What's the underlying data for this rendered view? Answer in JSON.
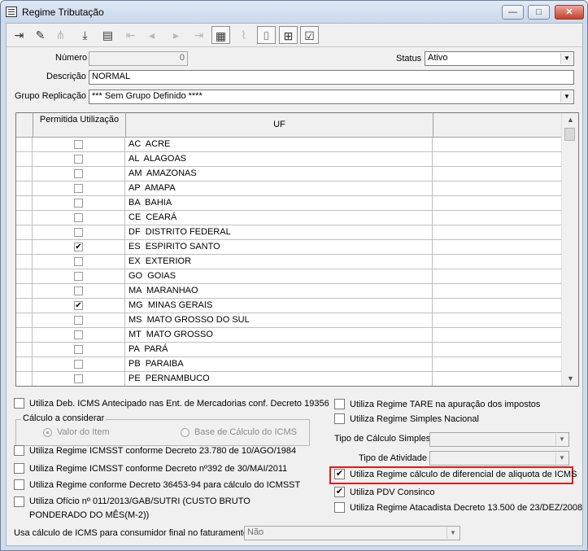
{
  "window": {
    "title": "Regime Tributação",
    "min_symbol": "—",
    "max_symbol": "□",
    "close_symbol": "✕"
  },
  "toolbar": {
    "icons": [
      {
        "name": "exit-icon",
        "glyph": "⇥",
        "enabled": true
      },
      {
        "name": "edit-icon",
        "glyph": "✎",
        "enabled": true
      },
      {
        "name": "tree-icon",
        "glyph": "⋔",
        "enabled": false
      },
      {
        "name": "download-icon",
        "glyph": "⤓",
        "enabled": true
      },
      {
        "name": "tray-icon",
        "glyph": "▤",
        "enabled": true
      },
      {
        "name": "first-icon",
        "glyph": "⇤",
        "enabled": false
      },
      {
        "name": "prev-icon",
        "glyph": "◂",
        "enabled": false
      },
      {
        "name": "next-icon",
        "glyph": "▸",
        "enabled": false
      },
      {
        "name": "last-icon",
        "glyph": "⇥",
        "enabled": false
      },
      {
        "name": "film-icon",
        "glyph": "▦",
        "enabled": true,
        "boxed": true
      },
      {
        "name": "chart-icon",
        "glyph": "⌇",
        "enabled": false
      },
      {
        "name": "camera-icon",
        "glyph": "⌷",
        "enabled": true,
        "boxed": true
      },
      {
        "name": "structure-icon",
        "glyph": "⊞",
        "enabled": true,
        "boxed": true
      },
      {
        "name": "checklist-icon",
        "glyph": "☑",
        "enabled": true,
        "boxed": true
      }
    ]
  },
  "form": {
    "numero_label": "Número",
    "numero_value": "0",
    "status_label": "Status",
    "status_value": "Ativo",
    "descricao_label": "Descrição",
    "descricao_value": "NORMAL",
    "grupo_label": "Grupo Replicação",
    "grupo_value": "*** Sem Grupo Definido ****"
  },
  "grid": {
    "col_permitida": "Permitida Utilização",
    "col_uf": "UF",
    "rows": [
      {
        "uf": "AC  ACRE",
        "checked": false
      },
      {
        "uf": "AL  ALAGOAS",
        "checked": false
      },
      {
        "uf": "AM  AMAZONAS",
        "checked": false
      },
      {
        "uf": "AP  AMAPA",
        "checked": false
      },
      {
        "uf": "BA  BAHIA",
        "checked": false
      },
      {
        "uf": "CE  CEARÁ",
        "checked": false
      },
      {
        "uf": "DF  DISTRITO FEDERAL",
        "checked": false
      },
      {
        "uf": "ES  ESPIRITO SANTO",
        "checked": true
      },
      {
        "uf": "EX  EXTERIOR",
        "checked": false
      },
      {
        "uf": "GO  GOIAS",
        "checked": false
      },
      {
        "uf": "MA  MARANHAO",
        "checked": false
      },
      {
        "uf": "MG  MINAS GERAIS",
        "checked": true
      },
      {
        "uf": "MS  MATO GROSSO DO SUL",
        "checked": false
      },
      {
        "uf": "MT  MATO GROSSO",
        "checked": false
      },
      {
        "uf": "PA  PARÁ",
        "checked": false
      },
      {
        "uf": "PB  PARAIBA",
        "checked": false
      },
      {
        "uf": "PE  PERNAMBUCO",
        "checked": false
      }
    ]
  },
  "left_options": {
    "deb_icms": {
      "label": "Utiliza Deb. ICMS Antecipado nas Ent. de Mercadorias conf. Decreto 19356",
      "checked": false
    },
    "calculo_group_title": "Cálculo a considerar",
    "radio_valor_item": "Valor do Item",
    "radio_base_calculo": "Base de Cálculo do ICMS",
    "icmsst_23780": {
      "label": "Utiliza Regime ICMSST conforme Decreto 23.780 de 10/AGO/1984",
      "checked": false
    },
    "icmsst_392": {
      "label": "Utiliza Regime ICMSST conforme Decreto nº392 de 30/MAI/2011",
      "checked": false
    },
    "decreto_36453": {
      "label": "Utiliza Regime conforme Decreto 36453-94 para cálculo do ICMSST",
      "checked": false
    },
    "oficio_011": {
      "label": "Utiliza Ofício nº 011/2013/GAB/SUTRI (CUSTO BRUTO PONDERADO DO MÊS(M-2))",
      "checked": false
    },
    "consumidor_final_label": "Usa cálculo de ICMS para consumidor final no faturamento",
    "consumidor_final_value": "Não"
  },
  "right_options": {
    "tare": {
      "label": "Utiliza Regime TARE na apuração dos impostos",
      "checked": false
    },
    "simples": {
      "label": "Utiliza Regime Simples Nacional",
      "checked": false
    },
    "tipo_calculo_label": "Tipo de Cálculo Simples",
    "tipo_calculo_value": "",
    "tipo_atividade_label": "Tipo de Atividade",
    "tipo_atividade_value": "",
    "diferencial_aliquota": {
      "label": "Utiliza Regime cálculo de diferencial de aliquota de ICMS",
      "checked": true
    },
    "pdv_consinco": {
      "label": "Utiliza PDV Consinco",
      "checked": true
    },
    "atacadista": {
      "label": "Utiliza Regime Atacadista Decreto 13.500 de 23/DEZ/2008",
      "checked": false
    }
  },
  "colors": {
    "highlight_border": "#e01b1b",
    "title_bar": "#cfdcec"
  }
}
